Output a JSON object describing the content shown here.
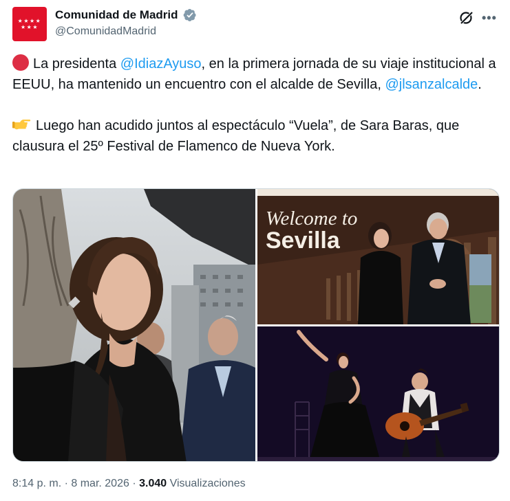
{
  "account": {
    "display_name": "Comunidad de Madrid",
    "handle": "@ComunidadMadrid",
    "verified": true,
    "avatar_icon": "madrid-flag-stars",
    "avatar_color": "#e1122a"
  },
  "post": {
    "line1_pre": "La presidenta ",
    "mention1": "@IdiazAyuso",
    "line1_post": ", en la primera jornada de su viaje institucional a EEUU, ha mantenido un encuentro con el alcalde de Sevilla, ",
    "mention2": "@jlsanzalcalde",
    "line1_end": ".",
    "paragraph2": "Luego han acudido juntos al espectáculo “Vuela”, de Sara Baras, que clausura el 25º Festival de Flamenco de Nueva York.",
    "emoji1": "red-circle",
    "emoji2": "backhand-index-pointing-right"
  },
  "media": {
    "photo2_sign_line1": "Welcome to",
    "photo2_sign_line2": "Sevilla"
  },
  "meta": {
    "time": "8:14 p. m.",
    "sep1": " · ",
    "date": "8 mar. 2026",
    "sep2": " · ",
    "views_count": "3.040",
    "views_label": "Visualizaciones"
  },
  "colors": {
    "accent_link": "#1d9bf0",
    "verified_badge": "#829aab",
    "secondary_text": "#536471"
  }
}
